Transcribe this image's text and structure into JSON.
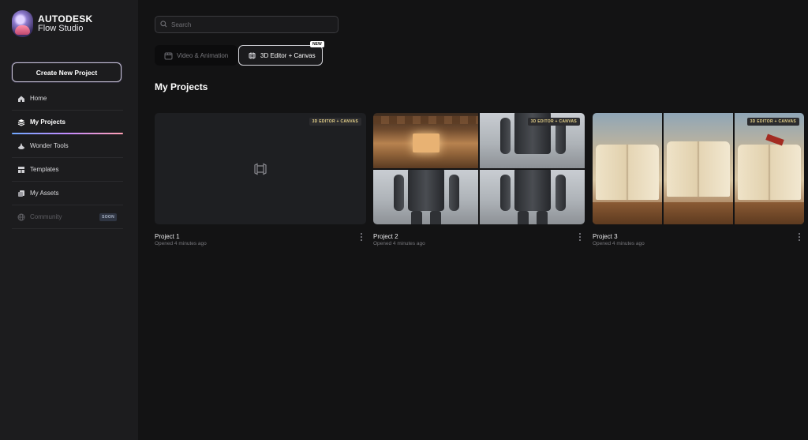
{
  "brand": {
    "name_line1": "AUTODESK",
    "name_line2": "Flow Studio"
  },
  "sidebar": {
    "create_label": "Create New Project",
    "items": [
      {
        "label": "Home",
        "icon": "home-icon"
      },
      {
        "label": "My Projects",
        "icon": "projects-icon",
        "active": true
      },
      {
        "label": "Wonder Tools",
        "icon": "wonder-tools-icon"
      },
      {
        "label": "Templates",
        "icon": "templates-icon"
      },
      {
        "label": "My Assets",
        "icon": "assets-icon"
      },
      {
        "label": "Community",
        "icon": "globe-icon",
        "badge": "SOON",
        "disabled": true
      }
    ]
  },
  "search": {
    "placeholder": "Search"
  },
  "tabs": [
    {
      "label": "Video & Animation",
      "icon": "video-icon"
    },
    {
      "label": "3D Editor + Canvas",
      "icon": "3d-editor-icon",
      "badge": "NEW",
      "selected": true
    }
  ],
  "section_title": "My Projects",
  "projects": [
    {
      "name": "Project 1",
      "meta": "Opened 4 minutes ago",
      "badge": "3D EDITOR + CANVAS"
    },
    {
      "name": "Project 2",
      "meta": "Opened 4 minutes ago",
      "badge": "3D EDITOR + CANVAS"
    },
    {
      "name": "Project 3",
      "meta": "Opened 4 minutes ago",
      "badge": "3D EDITOR + CANVAS"
    }
  ],
  "colors": {
    "background": "#131314",
    "sidebar": "#1c1c1e",
    "badge_text": "#e7d38a"
  }
}
